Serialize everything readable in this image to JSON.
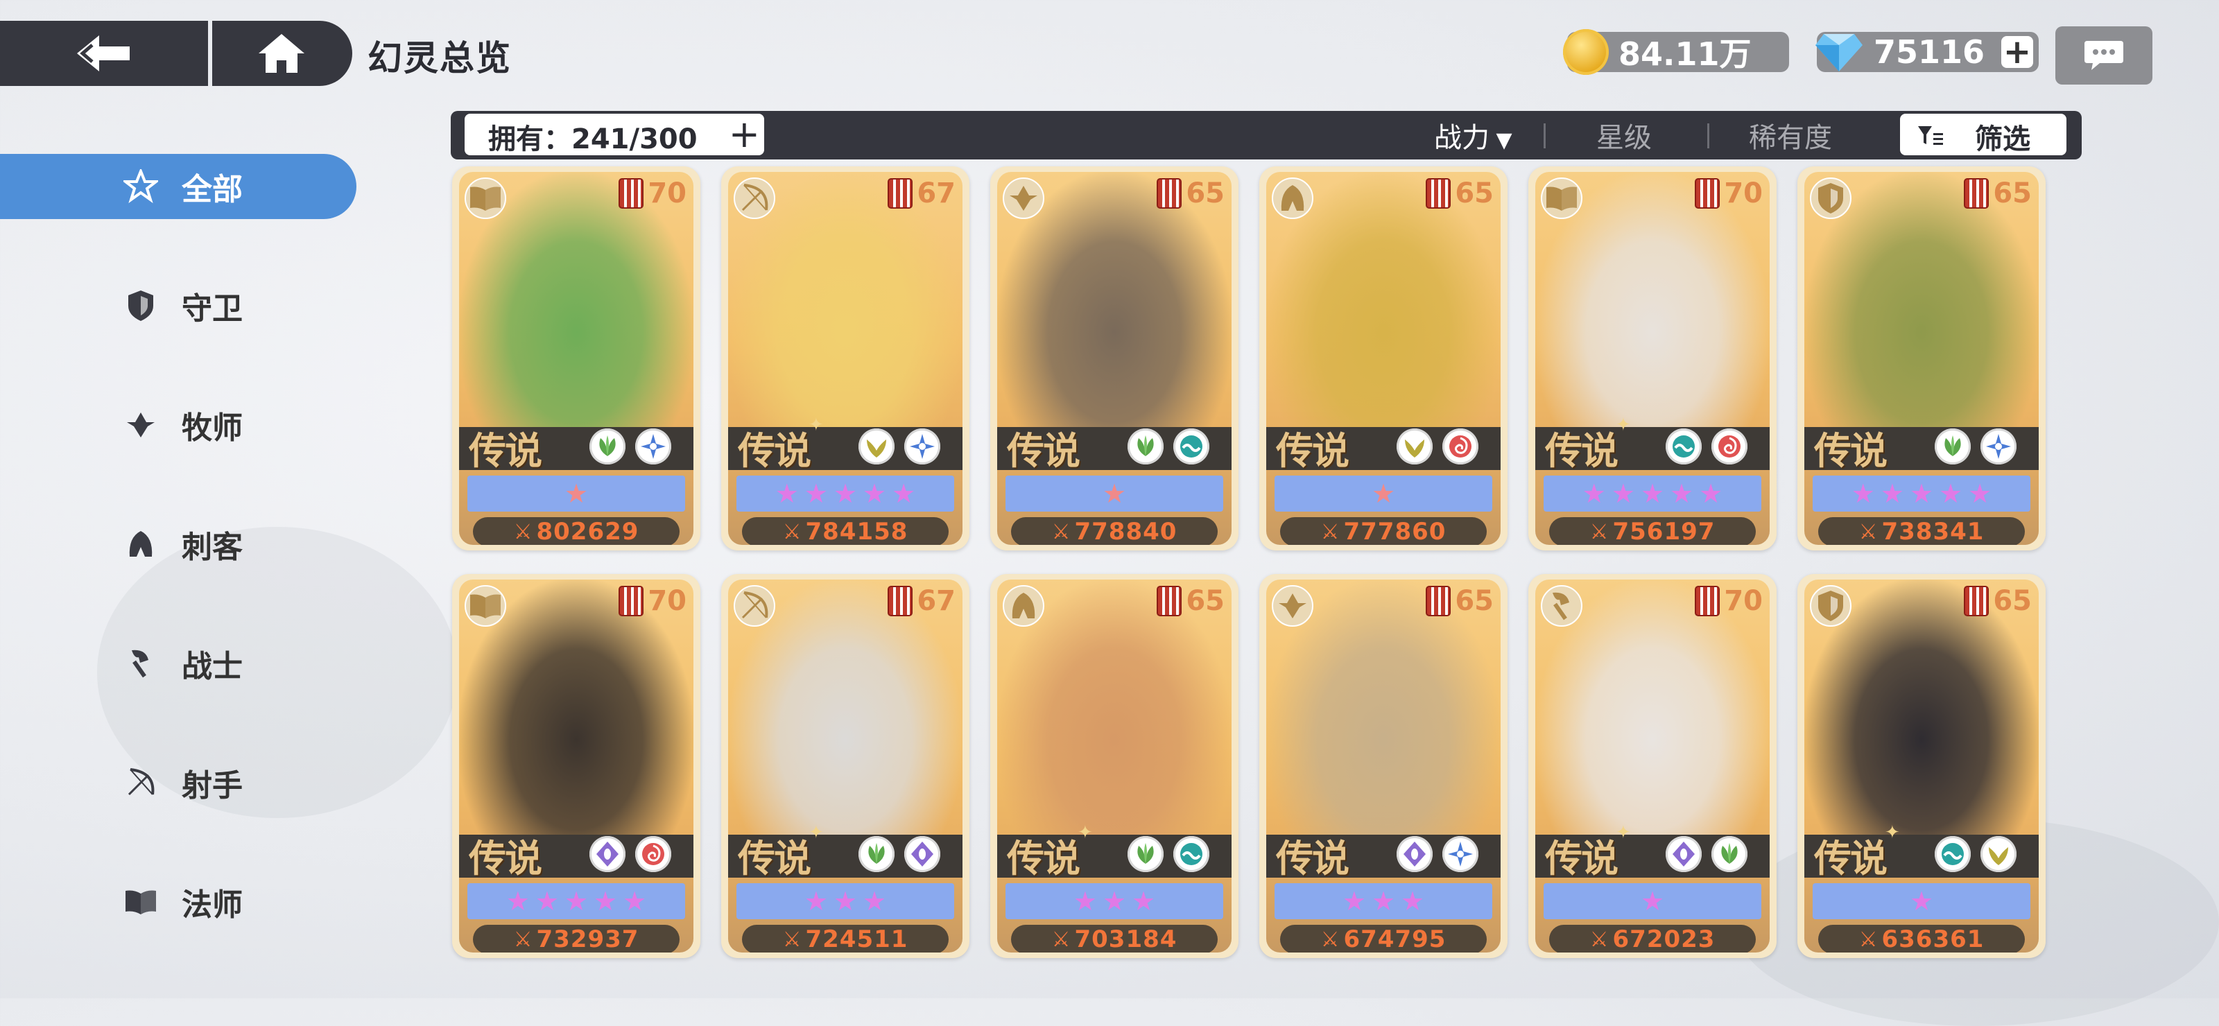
{
  "header": {
    "title": "幻灵总览",
    "gold": "84.11万",
    "diamonds": "75116"
  },
  "sidebar": {
    "items": [
      {
        "label": "全部",
        "icon": "star-all-icon",
        "active": true
      },
      {
        "label": "守卫",
        "icon": "shield-icon",
        "active": false
      },
      {
        "label": "牧师",
        "icon": "priest-icon",
        "active": false
      },
      {
        "label": "刺客",
        "icon": "assassin-icon",
        "active": false
      },
      {
        "label": "战士",
        "icon": "warrior-axe-icon",
        "active": false
      },
      {
        "label": "射手",
        "icon": "bow-icon",
        "active": false
      },
      {
        "label": "法师",
        "icon": "book-icon",
        "active": false
      }
    ]
  },
  "toolbar": {
    "owned": "拥有：241/300",
    "sort_power": "战力",
    "sort_stars": "星级",
    "sort_rarity": "稀有度",
    "filter": "筛选"
  },
  "colors": {
    "accent_blue": "#4f8fd8",
    "dark_bar": "#35363e",
    "power_orange": "#f2753a",
    "star_bar": "#8aa9ee"
  },
  "cards": [
    {
      "class_icon": "book-icon",
      "level": "70",
      "rarity": "传说",
      "plus": false,
      "elements": [
        "nature",
        "light"
      ],
      "stars": 1,
      "star_color": "#f08a8a",
      "power": "802629",
      "art": "#6fae58"
    },
    {
      "class_icon": "bow-icon",
      "level": "67",
      "rarity": "传说",
      "plus": true,
      "elements": [
        "wind",
        "light"
      ],
      "stars": 5,
      "star_color": "#e07ae6",
      "power": "784158",
      "art": "#f1d06f"
    },
    {
      "class_icon": "priest-icon",
      "level": "65",
      "rarity": "传说",
      "plus": false,
      "elements": [
        "nature",
        "water"
      ],
      "stars": 1,
      "star_color": "#f08a8a",
      "power": "778840",
      "art": "#7a6a5a"
    },
    {
      "class_icon": "assassin-icon",
      "level": "65",
      "rarity": "传说",
      "plus": false,
      "elements": [
        "wind",
        "fire"
      ],
      "stars": 1,
      "star_color": "#f08a8a",
      "power": "777860",
      "art": "#d8b34a"
    },
    {
      "class_icon": "book-icon",
      "level": "70",
      "rarity": "传说",
      "plus": true,
      "elements": [
        "water",
        "fire"
      ],
      "stars": 5,
      "star_color": "#e07ae6",
      "power": "756197",
      "art": "#e8e2dc"
    },
    {
      "class_icon": "shield-icon",
      "level": "65",
      "rarity": "传说",
      "plus": false,
      "elements": [
        "nature",
        "light"
      ],
      "stars": 5,
      "star_color": "#e07ae6",
      "power": "738341",
      "art": "#8f9a4c"
    },
    {
      "class_icon": "book-icon",
      "level": "70",
      "rarity": "传说",
      "plus": false,
      "elements": [
        "dark",
        "fire"
      ],
      "stars": 5,
      "star_color": "#e07ae6",
      "power": "732937",
      "art": "#3c342e"
    },
    {
      "class_icon": "bow-icon",
      "level": "67",
      "rarity": "传说",
      "plus": true,
      "elements": [
        "nature",
        "dark"
      ],
      "stars": 3,
      "star_color": "#e07ae6",
      "power": "724511",
      "art": "#dcdad8"
    },
    {
      "class_icon": "assassin-icon",
      "level": "65",
      "rarity": "传说",
      "plus": true,
      "elements": [
        "nature",
        "water"
      ],
      "stars": 3,
      "star_color": "#e07ae6",
      "power": "703184",
      "art": "#d79a66"
    },
    {
      "class_icon": "priest-icon",
      "level": "65",
      "rarity": "传说",
      "plus": false,
      "elements": [
        "dark",
        "light"
      ],
      "stars": 3,
      "star_color": "#e07ae6",
      "power": "674795",
      "art": "#c8b08a"
    },
    {
      "class_icon": "warrior-axe-icon",
      "level": "70",
      "rarity": "传说",
      "plus": true,
      "elements": [
        "dark",
        "nature"
      ],
      "stars": 1,
      "star_color": "#e07ae6",
      "power": "672023",
      "art": "#e9e4e0"
    },
    {
      "class_icon": "shield-icon",
      "level": "65",
      "rarity": "传说",
      "plus": true,
      "elements": [
        "water",
        "wind"
      ],
      "stars": 1,
      "star_color": "#e07ae6",
      "power": "636361",
      "art": "#2f2c31"
    }
  ]
}
